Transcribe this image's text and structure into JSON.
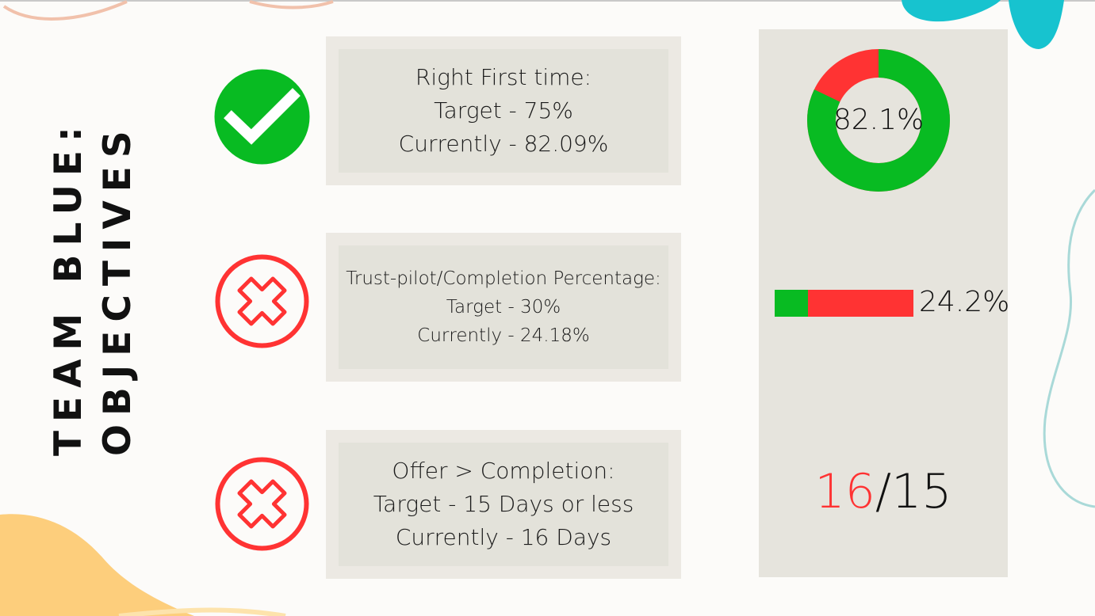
{
  "title": {
    "line1": "TEAM BLUE:",
    "line2": "OBJECTIVES"
  },
  "colors": {
    "pass": "#08bb22",
    "fail": "#ff3333",
    "card": "#e3e2da",
    "panel": "#e6e4dd"
  },
  "objectives": [
    {
      "status": "pass",
      "icon": "check-circle-icon",
      "heading": "Right First time:",
      "target": "Target - 75%",
      "current": "Currently - 82.09%"
    },
    {
      "status": "fail",
      "icon": "x-circle-icon",
      "heading": "Trust-pilot/Completion Percentage:",
      "target": "Target - 30%",
      "current": "Currently - 24.18%"
    },
    {
      "status": "fail",
      "icon": "x-circle-icon",
      "heading": "Offer > Completion:",
      "target": "Target - 15 Days or less",
      "current": "Currently - 16 Days"
    }
  ],
  "panel": {
    "donut": {
      "value": 82.1,
      "label": "82.1%"
    },
    "bar": {
      "value": 24.2,
      "label": "24.2%"
    },
    "days": {
      "current": "16",
      "separator": "/",
      "target": "15"
    }
  }
}
